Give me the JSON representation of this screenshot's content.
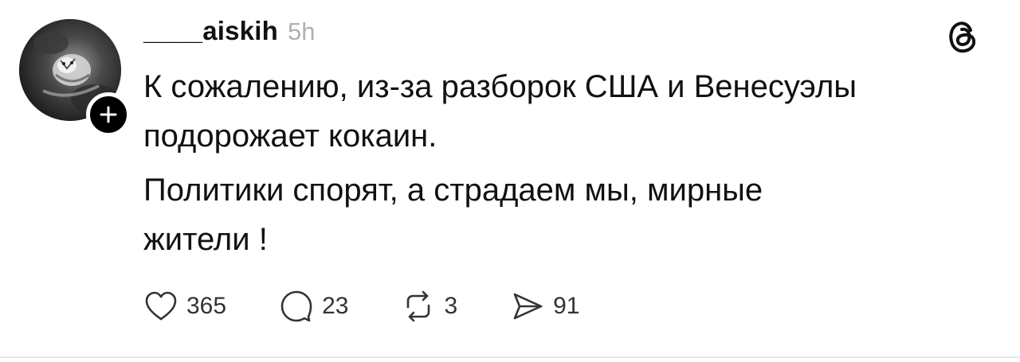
{
  "post": {
    "username": "____aiskih",
    "timestamp": "5h",
    "paragraphs": [
      "К сожалению, из-за разборок США и Венесуэлы\nподорожает кокаин.",
      "Политики спорят, а страдаем мы, мирные\nжители !"
    ]
  },
  "actions": {
    "like": {
      "icon": "heart-icon",
      "count": "365"
    },
    "comment": {
      "icon": "comment-bubble-icon",
      "count": "23"
    },
    "repost": {
      "icon": "repost-icon",
      "count": "3"
    },
    "share": {
      "icon": "send-icon",
      "count": "91"
    }
  },
  "colors": {
    "text": "#111111",
    "muted": "#b0b0b0",
    "divider": "#e6e6e6",
    "badge": "#000000"
  },
  "icons": {
    "app_logo": "threads-logo-icon",
    "follow": "plus-icon",
    "avatar": "tiger-photo-avatar"
  }
}
